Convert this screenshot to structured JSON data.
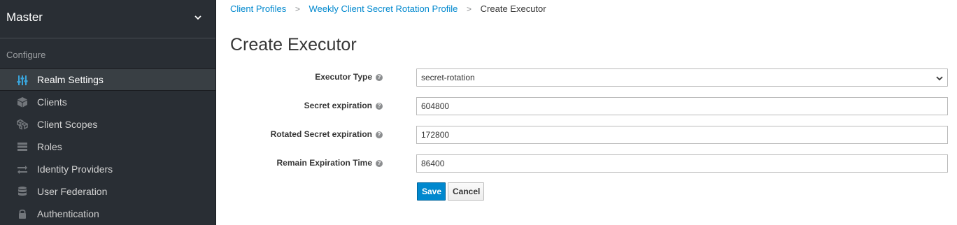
{
  "sidebar": {
    "realm": "Master",
    "section": "Configure",
    "items": [
      {
        "label": "Realm Settings",
        "icon": "sliders-icon"
      },
      {
        "label": "Clients",
        "icon": "cube-icon"
      },
      {
        "label": "Client Scopes",
        "icon": "cubes-icon"
      },
      {
        "label": "Roles",
        "icon": "roles-icon"
      },
      {
        "label": "Identity Providers",
        "icon": "exchange-icon"
      },
      {
        "label": "User Federation",
        "icon": "database-icon"
      },
      {
        "label": "Authentication",
        "icon": "lock-icon"
      }
    ]
  },
  "breadcrumb": {
    "items": [
      "Client Profiles",
      "Weekly Client Secret Rotation Profile"
    ],
    "current": "Create Executor"
  },
  "page": {
    "title": "Create Executor"
  },
  "form": {
    "executor_type": {
      "label": "Executor Type",
      "value": "secret-rotation"
    },
    "secret_expiration": {
      "label": "Secret expiration",
      "value": "604800"
    },
    "rotated_secret_expiration": {
      "label": "Rotated Secret expiration",
      "value": "172800"
    },
    "remain_expiration_time": {
      "label": "Remain Expiration Time",
      "value": "86400"
    }
  },
  "buttons": {
    "save": "Save",
    "cancel": "Cancel"
  },
  "colors": {
    "sidebar_bg": "#292e34",
    "link": "#0088ce",
    "primary": "#0088ce",
    "active_icon": "#39a5dc"
  }
}
